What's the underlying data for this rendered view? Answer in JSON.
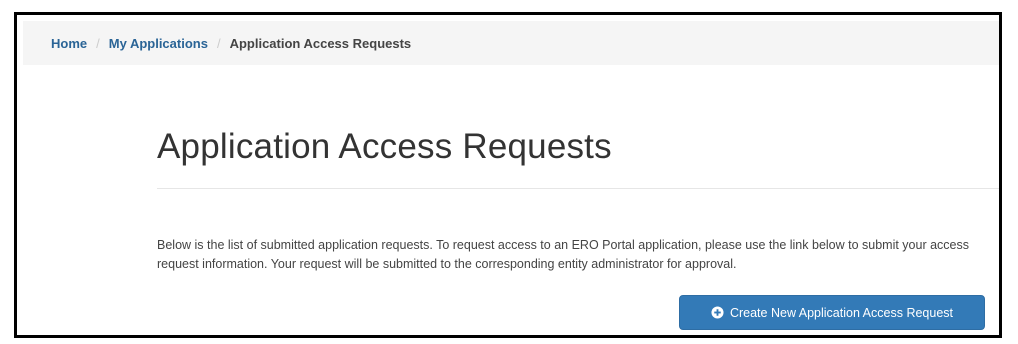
{
  "breadcrumb": {
    "items": [
      {
        "label": "Home"
      },
      {
        "label": "My Applications"
      },
      {
        "label": "Application Access Requests"
      }
    ],
    "separator": "/"
  },
  "page": {
    "title": "Application Access Requests",
    "description": "Below is the list of submitted application requests.  To request access to an ERO Portal application, please use the link below to submit your access request information.  Your request will be submitted to the corresponding entity administrator for approval."
  },
  "actions": {
    "create_button_label": "Create New Application Access Request",
    "create_button_icon": "plus-circle-icon"
  },
  "colors": {
    "link": "#2a6496",
    "primary_button": "#337ab7",
    "breadcrumb_bg": "#f5f5f5"
  }
}
